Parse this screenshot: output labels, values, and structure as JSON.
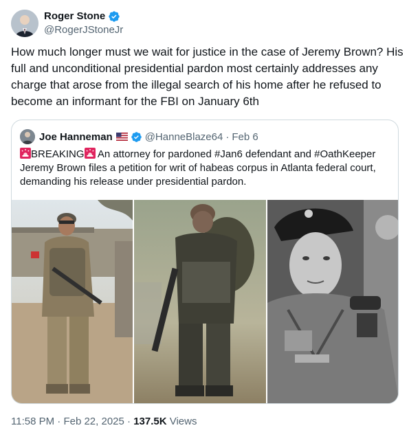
{
  "author": {
    "display_name": "Roger Stone",
    "handle": "@RogerJStoneJr",
    "avatar_icon": "profile-photo",
    "verified_icon": "verified-badge-icon",
    "verified_color": "#1d9bf0"
  },
  "tweet": {
    "text": "How much longer must we wait for justice in the case of Jeremy Brown? His full and unconditional presidential pardon most certainly addresses any charge that arose from the illegal search of his home after he refused to become an informant for the FBI on January 6th"
  },
  "quote": {
    "display_name": "Joe Hanneman",
    "flag_icon": "us-flag-icon",
    "handle": "@HanneBlaze64",
    "separator": "·",
    "date": "Feb 6",
    "breaking": "BREAKING",
    "siren_icon": "siren-icon",
    "text_rest": " An attorney for pardoned #Jan6 defendant and #OathKeeper Jeremy Brown files a petition for writ of habeas corpus in Atlanta federal court, demanding his release under presidential pardon.",
    "media": [
      {
        "name": "photo-soldier-desert"
      },
      {
        "name": "photo-soldier-field"
      },
      {
        "name": "photo-soldier-portrait-bw"
      }
    ]
  },
  "meta": {
    "time": "11:58 PM",
    "separator": "·",
    "date": "Feb 22, 2025",
    "views_count": "137.5K",
    "views_label": "Views"
  },
  "colors": {
    "text": "#0f1419",
    "secondary": "#536471",
    "border": "#cfd9de",
    "accent": "#1d9bf0"
  }
}
